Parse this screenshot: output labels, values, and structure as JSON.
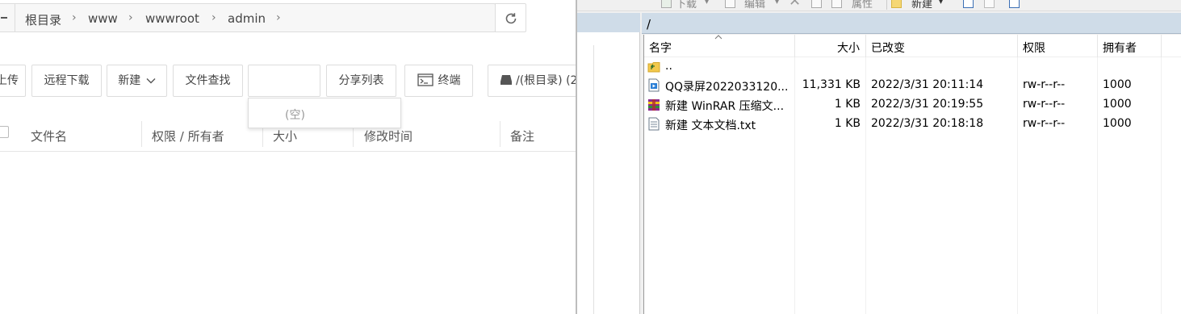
{
  "web_panel": {
    "breadcrumb": [
      "根目录",
      "www",
      "wwwroot",
      "admin"
    ],
    "toolbar": {
      "upload": "上传",
      "remote_download": "远程下载",
      "new": "新建",
      "file_search": "文件查找",
      "search_value": "",
      "share_list": "分享列表",
      "terminal": "终端",
      "disk": "/(根目录) (2"
    },
    "dropdown_empty": "(空)",
    "table_headers": {
      "name": "文件名",
      "perm_owner": "权限 / 所有者",
      "size": "大小",
      "mtime": "修改时间",
      "note": "备注"
    }
  },
  "ftp_panel": {
    "toolbar": {
      "download": "下载",
      "edit": "编辑",
      "properties": "属性",
      "new": "新建"
    },
    "path": "/",
    "columns": {
      "name": "名字",
      "size": "大小",
      "modified": "已改变",
      "perms": "权限",
      "owner": "拥有者"
    },
    "parent_dir": "..",
    "files": [
      {
        "icon": "video-file-icon",
        "name": "QQ录屏2022033120...",
        "size": "11,331 KB",
        "modified": "2022/3/31 20:11:14",
        "perms": "rw-r--r--",
        "owner": "1000"
      },
      {
        "icon": "winrar-archive-icon",
        "name": "新建 WinRAR 压缩文...",
        "size": "1 KB",
        "modified": "2022/3/31 20:19:55",
        "perms": "rw-r--r--",
        "owner": "1000"
      },
      {
        "icon": "text-file-icon",
        "name": "新建 文本文档.txt",
        "size": "1 KB",
        "modified": "2022/3/31 20:18:18",
        "perms": "rw-r--r--",
        "owner": "1000"
      }
    ]
  }
}
